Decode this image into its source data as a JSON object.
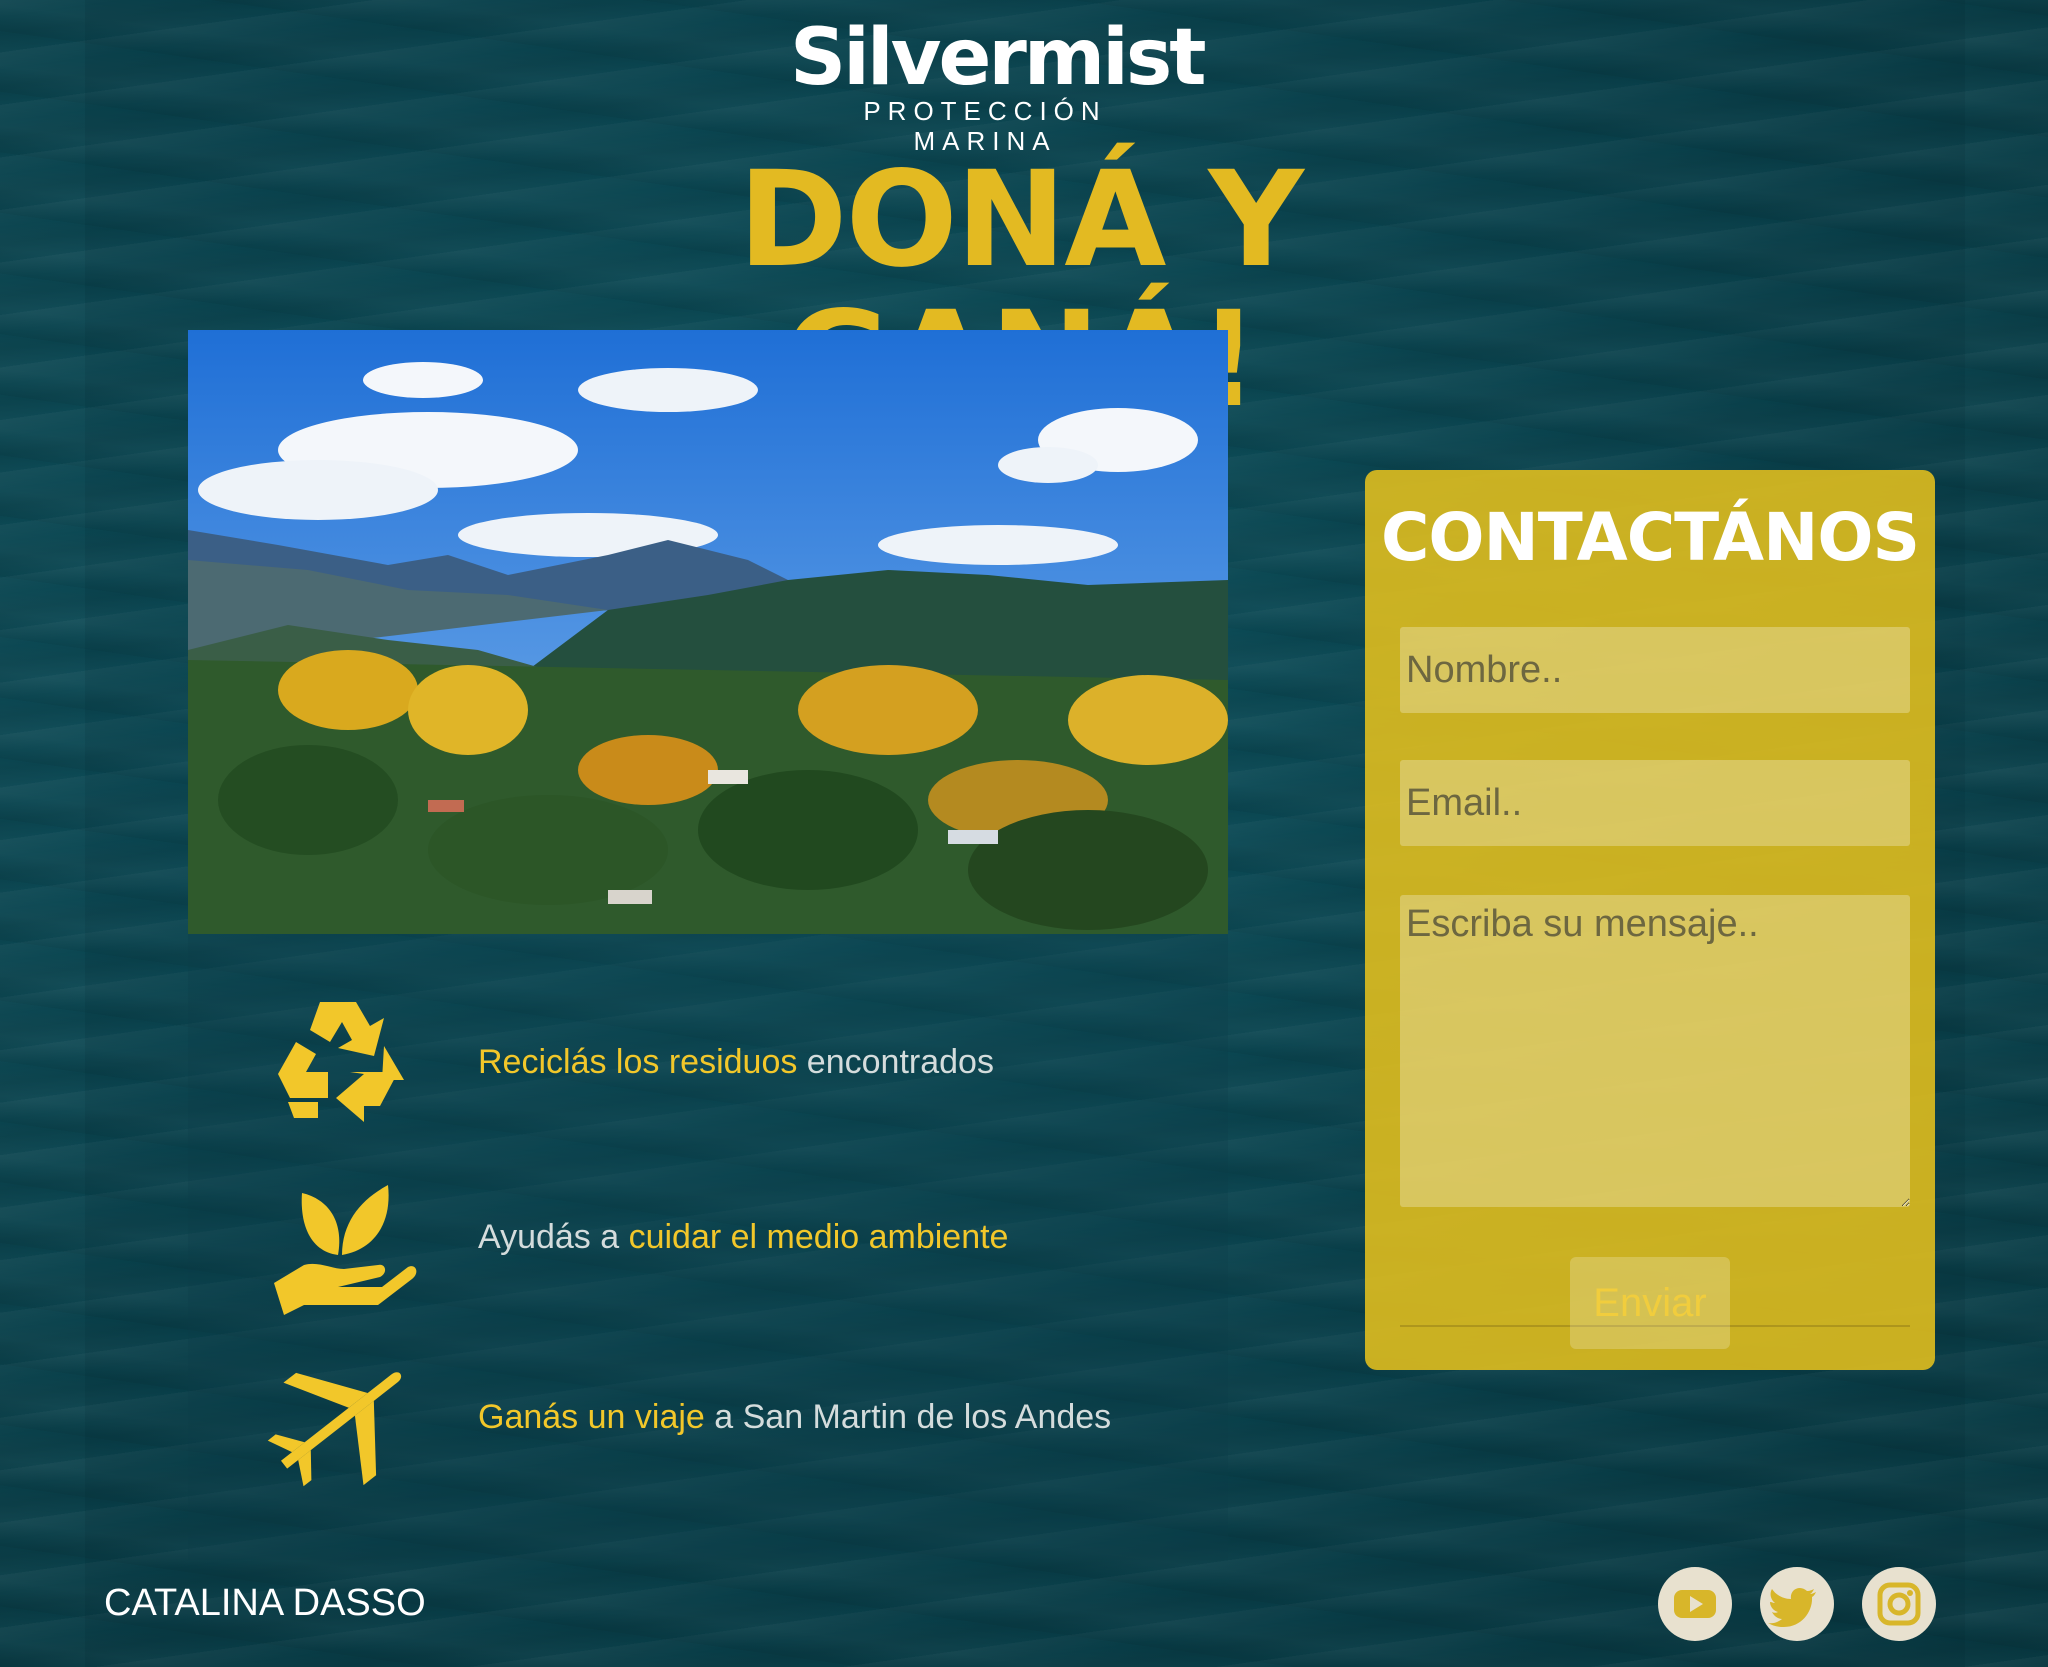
{
  "header": {
    "logo_name": "Silvermist",
    "logo_tagline": "PROTECCIÓN MARINA",
    "title": "DONÁ Y GANÁ!"
  },
  "features": [
    {
      "icon": "recycle-icon",
      "highlight": "Reciclás los residuos",
      "rest": " encontrados"
    },
    {
      "icon": "hand-plant-icon",
      "lead": "Ayudás a ",
      "highlight": "cuidar el medio ambiente"
    },
    {
      "icon": "airplane-icon",
      "highlight": "Ganás un viaje",
      "rest": " a San Martin de los Andes"
    }
  ],
  "contact": {
    "title": "CONTACTÁNOS",
    "name_placeholder": "Nombre..",
    "email_placeholder": "Email..",
    "message_placeholder": "Escriba su mensaje..",
    "submit_label": "Enviar"
  },
  "footer": {
    "author": "CATALINA DASSO",
    "social": [
      "youtube-icon",
      "twitter-icon",
      "instagram-icon"
    ]
  },
  "colors": {
    "accent": "#e3ba22",
    "contact_bg": "#e5c01c",
    "ocean": "#0b4651"
  }
}
